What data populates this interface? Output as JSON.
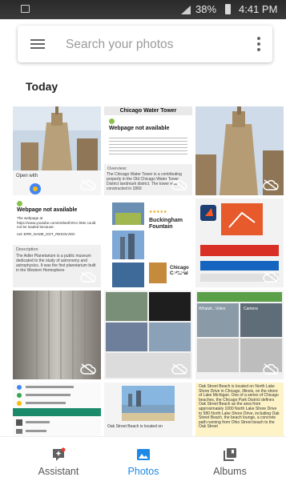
{
  "status_bar": {
    "battery": "38%",
    "time": "4:41 PM"
  },
  "search": {
    "placeholder": "Search your photos"
  },
  "section": {
    "title": "Today"
  },
  "tiles": {
    "t2": {
      "title": "Chicago Water Tower",
      "error": "Webpage not available",
      "overview_label": "Overview:",
      "overview_text": "The Chicago Water Tower is a contributing property in the Old Chicago Water Tower District landmark district. The tower was constructed in 1869"
    },
    "t1": {
      "open_with": "Open with"
    },
    "t4": {
      "error": "Webpage not available",
      "body": "The webpage at https://www.youtube.com/embed/VKIA.hMx could not be loaded because:",
      "err_code": "net::ERR_NAME_NOT_RESOLVED",
      "description_label": "Description",
      "description": "The Adler Planetarium is a public museum dedicated to the study of astronomy and astrophysics. It was the first planetarium built in the Western Hemisphere"
    },
    "t5": {
      "title": "Buckingham Fountain",
      "lower_title": "Chicago Cultural"
    },
    "t9": {
      "left": "Whatsit...Video",
      "right": "Camera"
    },
    "t11": {
      "caption": "Oak Street Beach is located on"
    },
    "t12": {
      "text": "Oak Street Beach is located on North Lake Shore Drive in Chicago, Illinois, on the shore of Lake Michigan. One of a series of Chicago beaches, the Chicago Park District defines Oak Street Beach as the area from approximately 1000 North Lake Shore Drive to 580 North Lake Shore Drive, including Oak Street Beach, the beach lounge, a concrete path running from Ohio Street beach to the Oak Street"
    }
  },
  "nav": {
    "assistant": "Assistant",
    "photos": "Photos",
    "albums": "Albums"
  },
  "colors": {
    "accent": "#1e88e5"
  }
}
